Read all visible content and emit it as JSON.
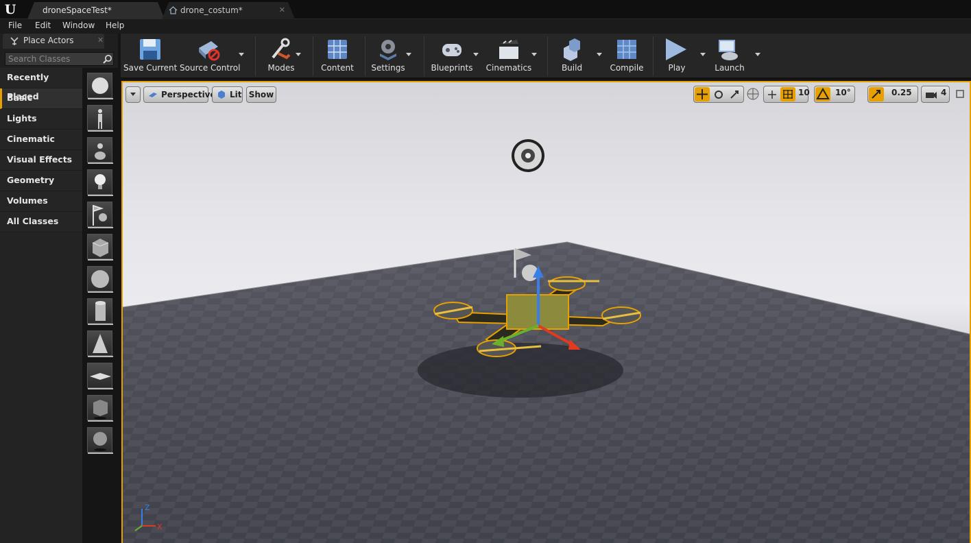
{
  "tabs": [
    {
      "label": "droneSpaceTest*",
      "active": true
    },
    {
      "label": "drone_costum*",
      "active": false
    }
  ],
  "menu": [
    "File",
    "Edit",
    "Window",
    "Help"
  ],
  "place_actors": {
    "title": "Place Actors",
    "search_placeholder": "Search Classes",
    "categories": [
      "Recently Placed",
      "Basic",
      "Lights",
      "Cinematic",
      "Visual Effects",
      "Geometry",
      "Volumes",
      "All Classes"
    ],
    "selected_category": "Basic",
    "thumbnail_icons": [
      "empty-actor-sphere-icon",
      "character-icon",
      "pawn-icon",
      "point-light-icon",
      "player-start-icon",
      "cube-icon",
      "sphere-icon",
      "cylinder-icon",
      "cone-icon",
      "plane-icon",
      "box-trigger-icon",
      "sphere-trigger-icon"
    ]
  },
  "toolbar": {
    "save": "Save Current",
    "source_control": "Source Control",
    "modes": "Modes",
    "content": "Content",
    "settings": "Settings",
    "blueprints": "Blueprints",
    "cinematics": "Cinematics",
    "build": "Build",
    "compile": "Compile",
    "play": "Play",
    "launch": "Launch"
  },
  "viewport": {
    "perspective": "Perspective",
    "lit": "Lit",
    "show": "Show",
    "grid_snap": "10",
    "rotation_snap": "10°",
    "scale_snap": "0.25",
    "camera_speed": "4",
    "axis_labels": {
      "z": "Z",
      "x": "X"
    }
  },
  "colors": {
    "accent": "#e8a000",
    "panel": "#1f1f1f",
    "toolbar": "#262626"
  }
}
